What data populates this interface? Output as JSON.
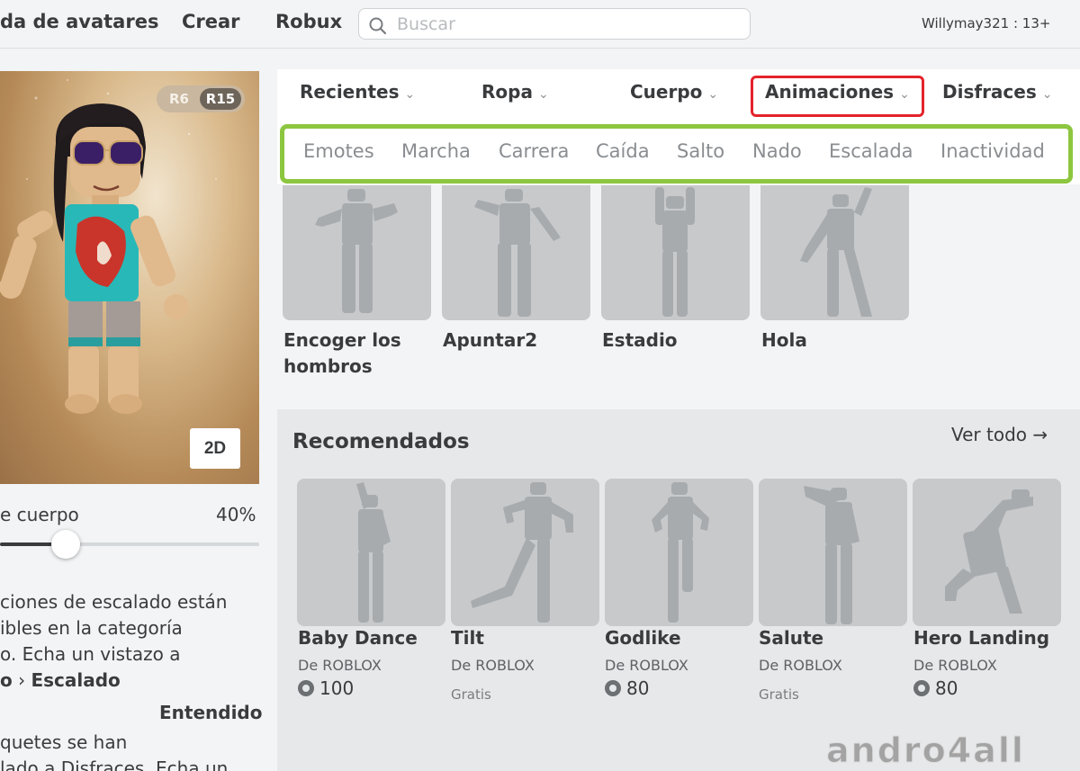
{
  "nav": {
    "avatar_shop": "da de avatares",
    "create": "Crear",
    "robux": "Robux",
    "search_placeholder": "Buscar",
    "username": "Willymay321 : 13+"
  },
  "avatar": {
    "toggle_r6": "R6",
    "toggle_r15": "R15",
    "view_2d": "2D",
    "body_label": "e cuerpo",
    "body_value": "40%",
    "body_fraction": 0.4
  },
  "info": {
    "line1": "ciones de escalado están",
    "line2": "ibles en la categoría",
    "line3": "o. Echa un vistazo a",
    "line4_prefix": "o",
    "line4_sep": " › ",
    "line4_link": "Escalado",
    "dismiss": "Entendido",
    "line5": "quetes se han",
    "line6": "lado a Disfraces. Echa un"
  },
  "categories": {
    "tabs": [
      {
        "label": "Recientes"
      },
      {
        "label": "Ropa"
      },
      {
        "label": "Cuerpo"
      },
      {
        "label": "Animaciones"
      },
      {
        "label": "Disfraces"
      }
    ],
    "subtabs": [
      "Emotes",
      "Marcha",
      "Carrera",
      "Caída",
      "Salto",
      "Nado",
      "Escalada",
      "Inactividad"
    ]
  },
  "items": [
    {
      "name_line1": "Encoger los",
      "name_line2": "hombros"
    },
    {
      "name_line1": "Apuntar2",
      "name_line2": ""
    },
    {
      "name_line1": "Estadio",
      "name_line2": ""
    },
    {
      "name_line1": "Hola",
      "name_line2": ""
    }
  ],
  "recommended": {
    "title": "Recomendados",
    "see_all": "Ver todo →",
    "items": [
      {
        "name": "Baby Dance",
        "creator": "De  ROBLOX",
        "price": "100",
        "free": ""
      },
      {
        "name": "Tilt",
        "creator": "De  ROBLOX",
        "price": "",
        "free": "Gratis"
      },
      {
        "name": "Godlike",
        "creator": "De  ROBLOX",
        "price": "80",
        "free": ""
      },
      {
        "name": "Salute",
        "creator": "De  ROBLOX",
        "price": "",
        "free": "Gratis"
      },
      {
        "name": "Hero Landing",
        "creator": "De  ROBLOX",
        "price": "80",
        "free": ""
      }
    ]
  },
  "watermark": "andro4all",
  "colors": {
    "highlight_red": "#e4232b",
    "highlight_green": "#8dc63f",
    "tile_gray": "#c7c9cb"
  }
}
